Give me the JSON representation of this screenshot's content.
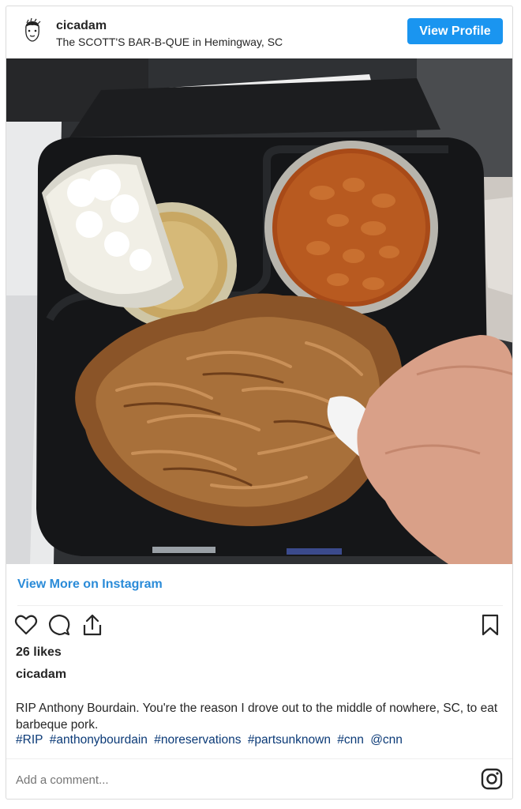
{
  "header": {
    "username": "cicadam",
    "location": "The SCOTT'S BAR-B-QUE in Hemingway, SC",
    "view_profile_label": "View Profile"
  },
  "post": {
    "view_more_label": "View More on Instagram",
    "likes": "26 likes",
    "owner": "cicadam",
    "caption": "RIP Anthony Bourdain. You're the reason I drove out to the middle of nowhere, SC, to eat barbeque pork.",
    "hashtags": [
      "#RIP",
      "#anthonybourdain",
      "#noreservations",
      "#partsunknown",
      "#cnn",
      "@cnn"
    ]
  },
  "comment": {
    "placeholder": "Add a comment..."
  },
  "colors": {
    "accent": "#1a95f0",
    "link": "#2a8bd8",
    "hashtag": "#0b3a77"
  },
  "icons": [
    "heart-icon",
    "comment-icon",
    "share-icon",
    "bookmark-icon",
    "instagram-icon"
  ]
}
